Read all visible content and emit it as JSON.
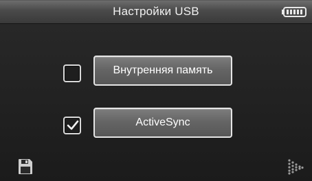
{
  "header": {
    "title": "Настройки USB"
  },
  "options": [
    {
      "label": "Внутренняя память",
      "checked": false
    },
    {
      "label": "ActiveSync",
      "checked": true
    }
  ],
  "icons": {
    "battery": "battery-icon",
    "save": "save-icon",
    "next": "next-arrow-icon",
    "check": "checkmark-icon"
  },
  "colors": {
    "background": "#1b1b1b",
    "header": "#4a4a4a",
    "button_fill": "#656565",
    "button_border": "#e6e6e6",
    "text": "#ffffff"
  }
}
